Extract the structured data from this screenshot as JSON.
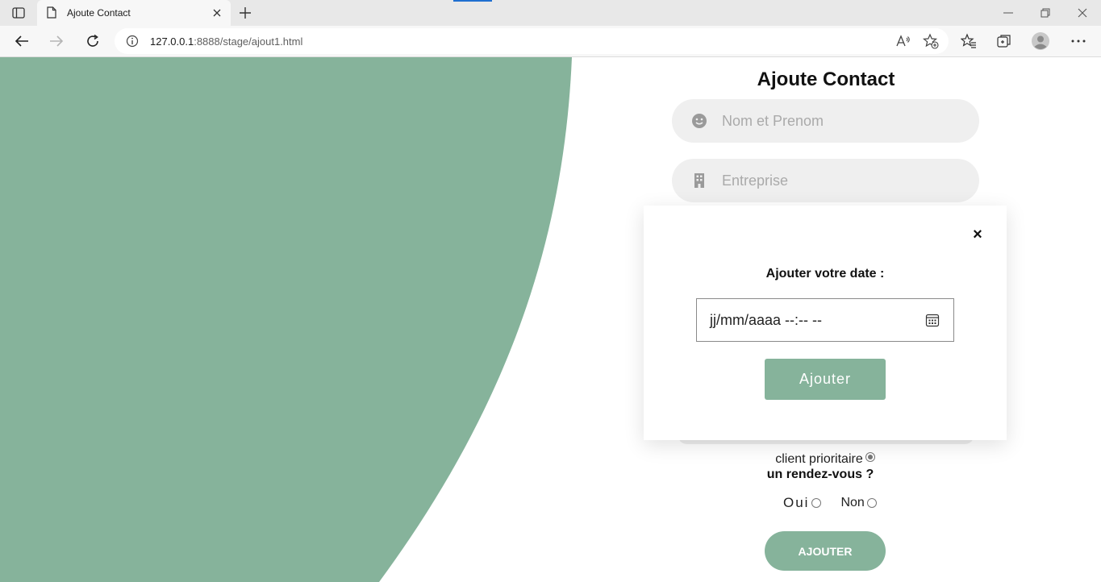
{
  "browser": {
    "tab_title": "Ajoute Contact",
    "url_host": "127.0.0.1",
    "url_path": ":8888/stage/ajout1.html"
  },
  "page": {
    "title": "Ajoute Contact",
    "name_placeholder": "Nom et Prenom",
    "company_placeholder": "Entreprise",
    "priority_label": "client prioritaire",
    "rdv_label": "un rendez-vous ?",
    "option_yes": "Oui",
    "option_no": "Non",
    "submit_label": "AJOUTER",
    "accent_color": "#86b39b"
  },
  "modal": {
    "label": "Ajouter votre date :",
    "date_placeholder": "jj/mm/aaaa --:-- --",
    "button_label": "Ajouter",
    "close_symbol": "×"
  }
}
